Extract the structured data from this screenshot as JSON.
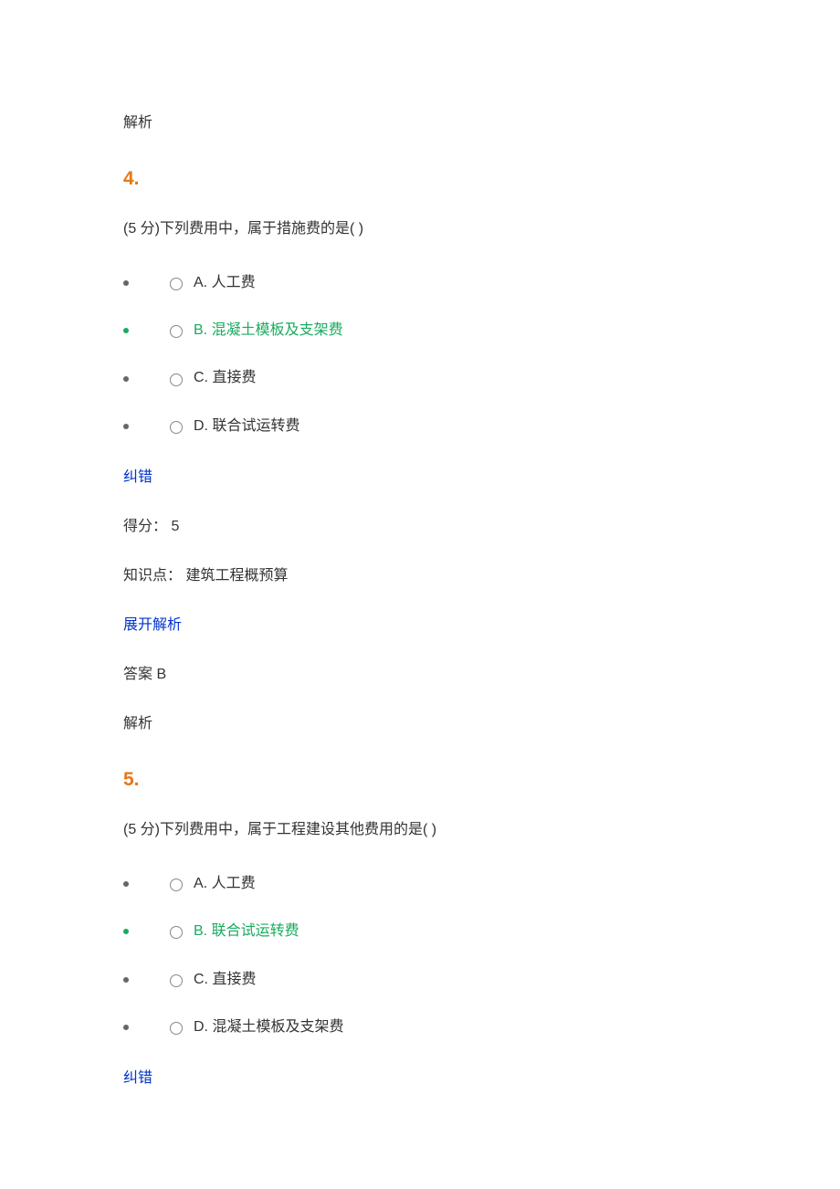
{
  "top_analysis_label": "解析",
  "questions": [
    {
      "number": "4.",
      "text": "(5 分)下列费用中，属于措施费的是(  )",
      "options": [
        {
          "label": "A. 人工费",
          "correct": false
        },
        {
          "label": "B. 混凝土模板及支架费",
          "correct": true
        },
        {
          "label": "C. 直接费",
          "correct": false
        },
        {
          "label": "D. 联合试运转费",
          "correct": false
        }
      ],
      "correction_link": "纠错",
      "score_label": "得分：",
      "score_value": "5",
      "knowledge_label": "知识点：",
      "knowledge_value": "建筑工程概预算",
      "expand_link": "展开解析",
      "answer_label": "答案",
      "answer_value": "B",
      "analysis_label": "解析"
    },
    {
      "number": "5.",
      "text": "(5 分)下列费用中，属于工程建设其他费用的是(  )",
      "options": [
        {
          "label": "A. 人工费",
          "correct": false
        },
        {
          "label": "B. 联合试运转费",
          "correct": true
        },
        {
          "label": "C. 直接费",
          "correct": false
        },
        {
          "label": "D. 混凝土模板及支架费",
          "correct": false
        }
      ],
      "correction_link": "纠错"
    }
  ]
}
